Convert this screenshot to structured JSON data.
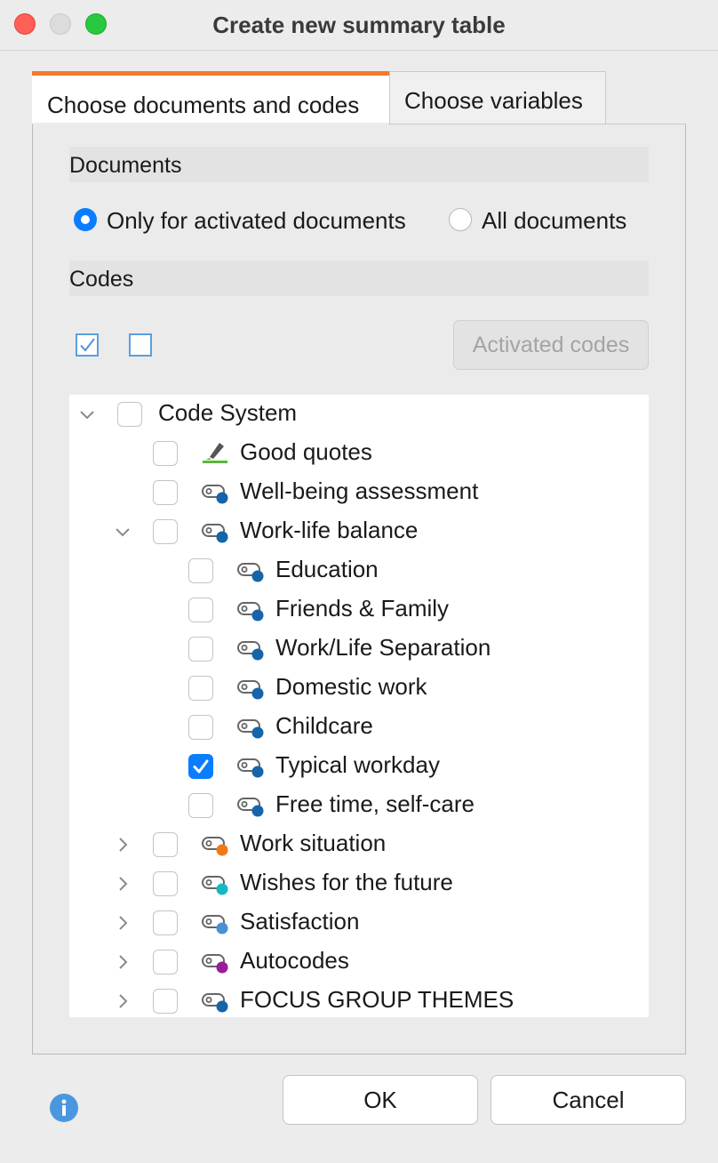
{
  "window": {
    "title": "Create new summary table"
  },
  "tabs": [
    {
      "label": "Choose documents and codes",
      "active": true
    },
    {
      "label": "Choose variables",
      "active": false
    }
  ],
  "documents": {
    "heading": "Documents",
    "options": [
      {
        "label": "Only for activated documents",
        "selected": true
      },
      {
        "label": "All documents",
        "selected": false
      }
    ]
  },
  "codes": {
    "heading": "Codes",
    "activated_button": "Activated codes"
  },
  "tree": {
    "root": {
      "label": "Code System",
      "expanded": true,
      "checked": false
    },
    "items": [
      {
        "label": "Good quotes",
        "icon": "highlighter-icon",
        "level": 1,
        "checked": false
      },
      {
        "label": "Well-being assessment",
        "icon": "code-tag-icon",
        "color": "#1565a8",
        "level": 1,
        "checked": false
      },
      {
        "label": "Work-life balance",
        "icon": "code-tag-icon",
        "color": "#1565a8",
        "level": 1,
        "checked": false,
        "expanded": true
      },
      {
        "label": "Education",
        "icon": "code-tag-icon",
        "color": "#1565a8",
        "level": 2,
        "checked": false
      },
      {
        "label": "Friends & Family",
        "icon": "code-tag-icon",
        "color": "#1565a8",
        "level": 2,
        "checked": false
      },
      {
        "label": "Work/Life Separation",
        "icon": "code-tag-icon",
        "color": "#1565a8",
        "level": 2,
        "checked": false
      },
      {
        "label": "Domestic work",
        "icon": "code-tag-icon",
        "color": "#1565a8",
        "level": 2,
        "checked": false
      },
      {
        "label": "Childcare",
        "icon": "code-tag-icon",
        "color": "#1565a8",
        "level": 2,
        "checked": false
      },
      {
        "label": "Typical workday",
        "icon": "code-tag-icon",
        "color": "#1565a8",
        "level": 2,
        "checked": true
      },
      {
        "label": "Free time, self-care",
        "icon": "code-tag-icon",
        "color": "#1565a8",
        "level": 2,
        "checked": false
      },
      {
        "label": "Work situation",
        "icon": "code-tag-icon",
        "color": "#f07a1a",
        "level": 1,
        "checked": false,
        "expanded": false
      },
      {
        "label": "Wishes for the future",
        "icon": "code-tag-icon",
        "color": "#17b8c4",
        "level": 1,
        "checked": false,
        "expanded": false
      },
      {
        "label": "Satisfaction",
        "icon": "code-tag-icon",
        "color": "#4a90d6",
        "level": 1,
        "checked": false,
        "expanded": false
      },
      {
        "label": "Autocodes",
        "icon": "code-tag-icon",
        "color": "#9a1a9a",
        "level": 1,
        "checked": false,
        "expanded": false
      },
      {
        "label": "FOCUS GROUP THEMES",
        "icon": "code-tag-icon",
        "color": "#1565a8",
        "level": 1,
        "checked": false,
        "expanded": false
      }
    ]
  },
  "footer": {
    "ok_label": "OK",
    "cancel_label": "Cancel"
  },
  "colors": {
    "accent_tab": "#f4792a",
    "checkbox_blue": "#0a7cff"
  }
}
